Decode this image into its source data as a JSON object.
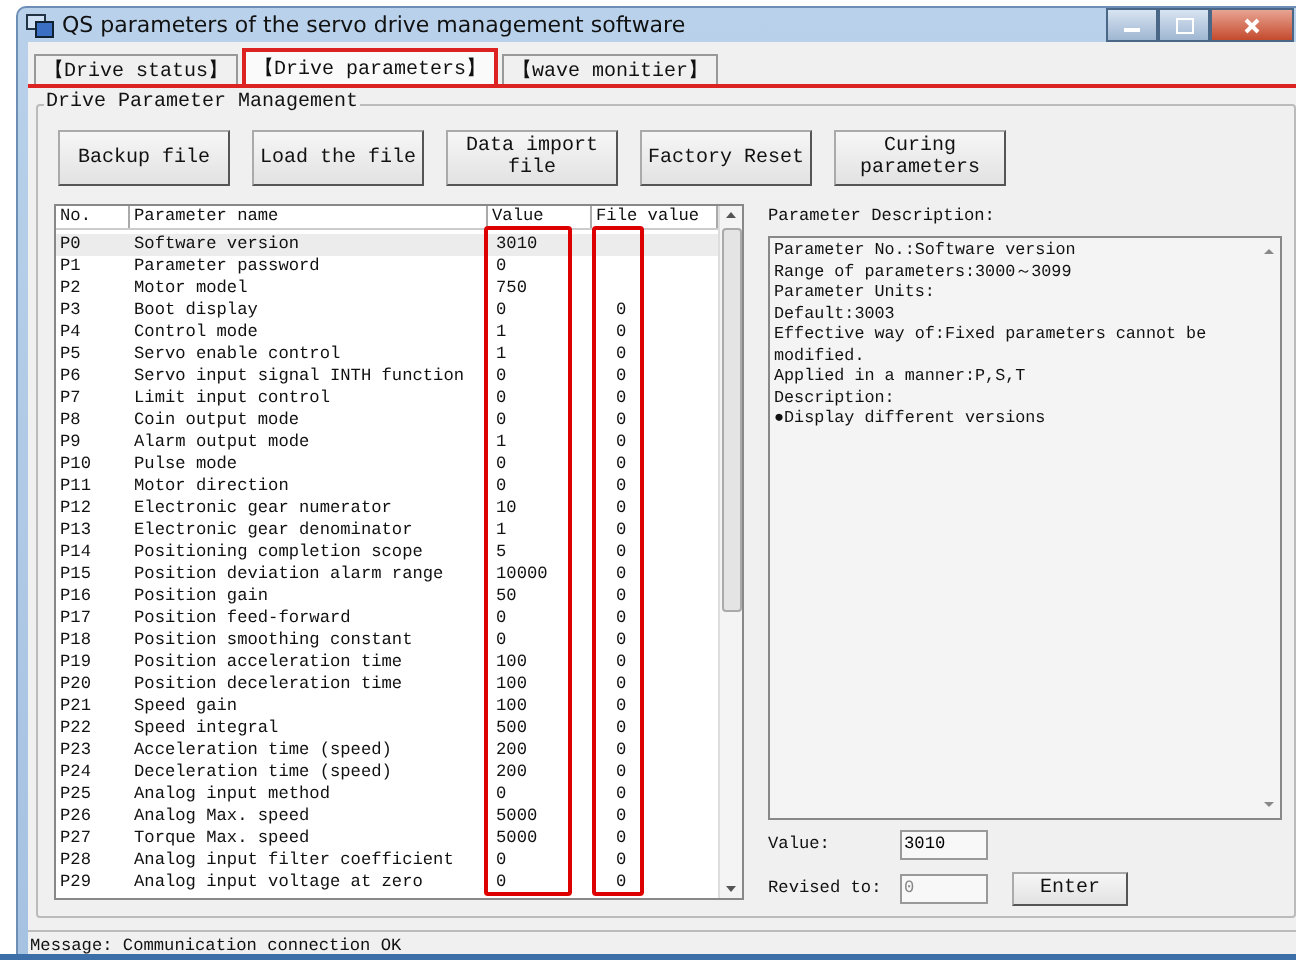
{
  "window": {
    "title": "QS parameters of the servo drive management software"
  },
  "tabs": [
    {
      "label": "【Drive status】",
      "selected": false
    },
    {
      "label": "【Drive parameters】",
      "selected": true
    },
    {
      "label": "【wave monitier】",
      "selected": false
    }
  ],
  "group_title": "Drive Parameter Management",
  "buttons": [
    "Backup file",
    "Load the file",
    "Data import file",
    "Factory Reset",
    "Curing parameters"
  ],
  "table": {
    "columns": [
      "No.",
      "Parameter name",
      "Value",
      "File value"
    ],
    "rows": [
      {
        "no": "P0",
        "name": "Software version",
        "value": "3010",
        "file_value": "",
        "selected": true
      },
      {
        "no": "P1",
        "name": "Parameter password",
        "value": "0",
        "file_value": "",
        "selected": false
      },
      {
        "no": "P2",
        "name": "Motor model",
        "value": "750",
        "file_value": "",
        "selected": false
      },
      {
        "no": "P3",
        "name": "Boot display",
        "value": "0",
        "file_value": "0",
        "selected": false
      },
      {
        "no": "P4",
        "name": "Control mode",
        "value": "1",
        "file_value": "0",
        "selected": false
      },
      {
        "no": "P5",
        "name": "Servo enable control",
        "value": "1",
        "file_value": "0",
        "selected": false
      },
      {
        "no": "P6",
        "name": "Servo input signal INTH function",
        "value": "0",
        "file_value": "0",
        "selected": false
      },
      {
        "no": "P7",
        "name": "Limit input control",
        "value": "0",
        "file_value": "0",
        "selected": false
      },
      {
        "no": "P8",
        "name": "Coin output mode",
        "value": "0",
        "file_value": "0",
        "selected": false
      },
      {
        "no": "P9",
        "name": "Alarm output mode",
        "value": "1",
        "file_value": "0",
        "selected": false
      },
      {
        "no": "P10",
        "name": "Pulse mode",
        "value": "0",
        "file_value": "0",
        "selected": false
      },
      {
        "no": "P11",
        "name": "Motor direction",
        "value": "0",
        "file_value": "0",
        "selected": false
      },
      {
        "no": "P12",
        "name": "Electronic gear numerator",
        "value": "10",
        "file_value": "0",
        "selected": false
      },
      {
        "no": "P13",
        "name": "Electronic gear denominator",
        "value": "1",
        "file_value": "0",
        "selected": false
      },
      {
        "no": "P14",
        "name": "Positioning completion scope",
        "value": "5",
        "file_value": "0",
        "selected": false
      },
      {
        "no": "P15",
        "name": "Position deviation alarm range",
        "value": "10000",
        "file_value": "0",
        "selected": false
      },
      {
        "no": "P16",
        "name": "Position gain",
        "value": "50",
        "file_value": "0",
        "selected": false
      },
      {
        "no": "P17",
        "name": "Position feed-forward",
        "value": "0",
        "file_value": "0",
        "selected": false
      },
      {
        "no": "P18",
        "name": "Position smoothing constant",
        "value": "0",
        "file_value": "0",
        "selected": false
      },
      {
        "no": "P19",
        "name": "Position acceleration time",
        "value": "100",
        "file_value": "0",
        "selected": false
      },
      {
        "no": "P20",
        "name": "Position deceleration time",
        "value": "100",
        "file_value": "0",
        "selected": false
      },
      {
        "no": "P21",
        "name": "Speed gain",
        "value": "100",
        "file_value": "0",
        "selected": false
      },
      {
        "no": "P22",
        "name": "Speed integral",
        "value": "500",
        "file_value": "0",
        "selected": false
      },
      {
        "no": "P23",
        "name": "Acceleration time (speed)",
        "value": "200",
        "file_value": "0",
        "selected": false
      },
      {
        "no": "P24",
        "name": "Deceleration time (speed)",
        "value": "200",
        "file_value": "0",
        "selected": false
      },
      {
        "no": "P25",
        "name": "Analog input method",
        "value": "0",
        "file_value": "0",
        "selected": false
      },
      {
        "no": "P26",
        "name": "Analog Max. speed",
        "value": "5000",
        "file_value": "0",
        "selected": false
      },
      {
        "no": "P27",
        "name": "Torque Max. speed",
        "value": "5000",
        "file_value": "0",
        "selected": false
      },
      {
        "no": "P28",
        "name": "Analog input filter coefficient",
        "value": "0",
        "file_value": "0",
        "selected": false
      },
      {
        "no": "P29",
        "name": "Analog input voltage at zero",
        "value": "0",
        "file_value": "0",
        "selected": false
      }
    ]
  },
  "description": {
    "label": "Parameter Description:",
    "lines": [
      "Parameter No.:Software version",
      "Range of parameters:3000～3099",
      "Parameter Units:",
      "Default:3003",
      "Effective way of:Fixed parameters cannot be modified.",
      "Applied in a manner:P,S,T",
      "Description:",
      "●Display different versions"
    ]
  },
  "value_label": "Value:",
  "value": "3010",
  "revised_label": "Revised to:",
  "revised_value": "0",
  "enter_button": "Enter",
  "status_bar": "Message: Communication connection OK"
}
